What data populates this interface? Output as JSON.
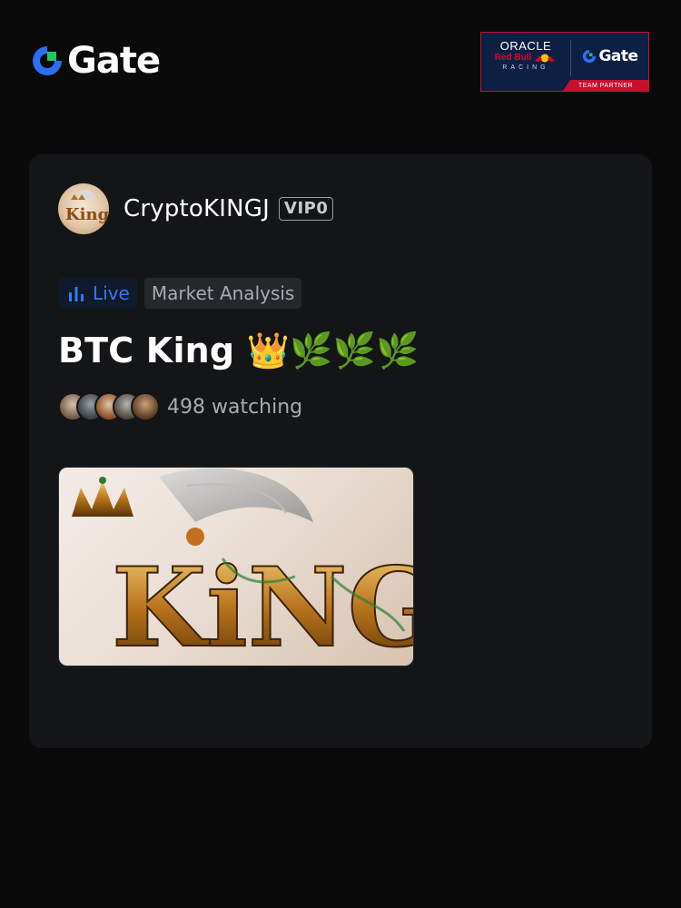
{
  "header": {
    "brand_name": "Gate",
    "partner_badge": {
      "oracle": "ORACLE",
      "redbull": "Red Bull",
      "racing": "RACING",
      "brand": "Gate",
      "caption": "TEAM PARTNER"
    }
  },
  "stream": {
    "host_name": "CryptoKINGJ",
    "vip_level": "VIP0",
    "status_label": "Live",
    "category": "Market Analysis",
    "title": "BTC King",
    "title_emoji": "👑🌿🌿🌿",
    "viewer_count_text": "498 watching",
    "thumbnail_text": "KiNG"
  },
  "colors": {
    "accent_blue": "#2f7cf6",
    "brand_green": "#22c55e",
    "partner_navy": "#0e1f44",
    "partner_red": "#c8102e",
    "card_bg": "#141517",
    "page_bg": "#0a0a0b"
  },
  "icons": {
    "live": "bar-chart-icon",
    "brand": "gate-logo-icon"
  }
}
